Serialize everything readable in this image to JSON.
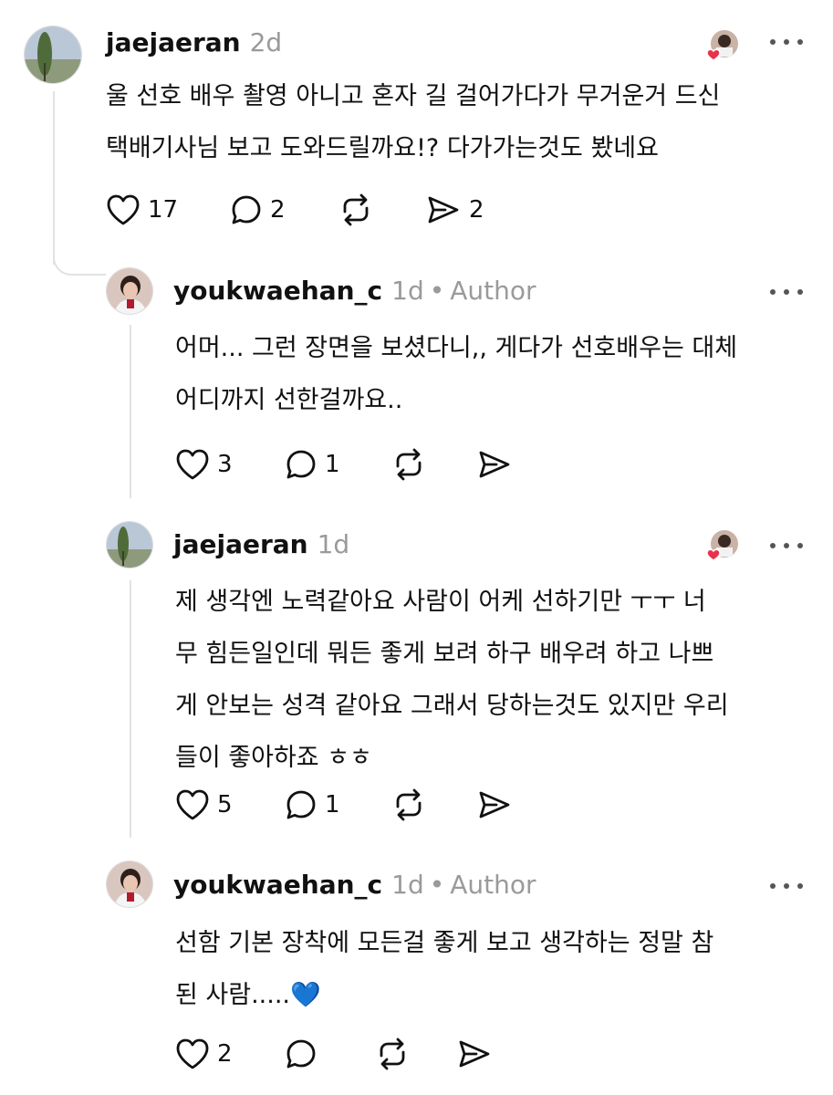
{
  "comments": [
    {
      "username": "jaejaeran",
      "time": "2d",
      "author_label": "",
      "avatar": "tree-landscape",
      "liked_by_author": true,
      "lines": [
        "울 선호 배우 촬영 아니고 혼자 길 걸어가다가 무거운거 드신",
        "택배기사님 보고 도와드릴까요!? 다가가는것도 봤네요"
      ],
      "likes": "17",
      "replies": "2",
      "reposts": "",
      "shares": "2"
    },
    {
      "username": "youkwaehan_c",
      "time": "1d",
      "author_label": "Author",
      "avatar": "person-portrait",
      "liked_by_author": false,
      "lines": [
        "어머... 그런 장면을 보셨다니,, 게다가 선호배우는 대체",
        "어디까지 선한걸까요.."
      ],
      "likes": "3",
      "replies": "1",
      "reposts": "",
      "shares": ""
    },
    {
      "username": "jaejaeran",
      "time": "1d",
      "author_label": "",
      "avatar": "tree-landscape",
      "liked_by_author": true,
      "lines": [
        "제 생각엔 노력같아요  사람이 어케 선하기만 ㅜㅜ 너",
        "무 힘든일인데 뭐든 좋게 보려 하구 배우려 하고 나쁘",
        "게 안보는 성격 같아요 그래서 당하는것도 있지만 우리",
        "들이 좋아하죠 ㅎㅎ"
      ],
      "likes": "5",
      "replies": "1",
      "reposts": "",
      "shares": ""
    },
    {
      "username": "youkwaehan_c",
      "time": "1d",
      "author_label": "Author",
      "avatar": "person-portrait",
      "liked_by_author": false,
      "lines": [
        "선함 기본 장착에 모든걸 좋게 보고 생각하는 정말 참",
        "된 사람.....💙"
      ],
      "likes": "2",
      "replies": "",
      "reposts": "",
      "shares": ""
    }
  ],
  "dot_separator": "•",
  "colors": {
    "heart_badge": "#e8334a",
    "thread_line": "#e2e2e2",
    "meta_gray": "#9a9a9a"
  }
}
